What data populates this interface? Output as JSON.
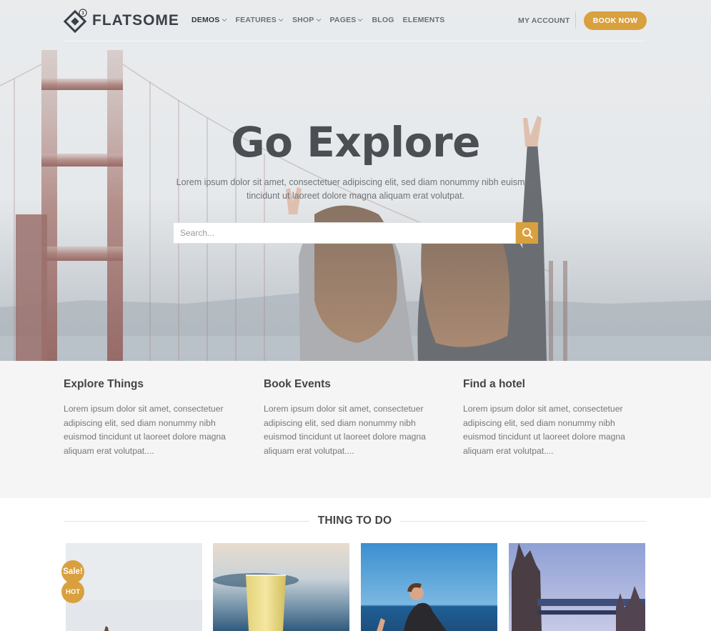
{
  "brand": {
    "name": "FLATSOME",
    "accent_color": "#d9a03e",
    "logo_badge": "3"
  },
  "nav": {
    "items": [
      {
        "label": "DEMOS",
        "has_dropdown": true,
        "active": true
      },
      {
        "label": "FEATURES",
        "has_dropdown": true,
        "active": false
      },
      {
        "label": "SHOP",
        "has_dropdown": true,
        "active": false
      },
      {
        "label": "PAGES",
        "has_dropdown": true,
        "active": false
      },
      {
        "label": "BLOG",
        "has_dropdown": false,
        "active": false
      },
      {
        "label": "ELEMENTS",
        "has_dropdown": false,
        "active": false
      }
    ],
    "account_label": "MY ACCOUNT",
    "cta_label": "BOOK NOW"
  },
  "hero": {
    "title": "Go Explore",
    "subtitle": "Lorem ipsum dolor sit amet, consectetuer adipiscing elit, sed diam nonummy nibh euismod tincidunt ut laoreet dolore magna aliquam erat volutpat.",
    "search_placeholder": "Search...",
    "search_value": ""
  },
  "features": [
    {
      "title": "Explore Things",
      "text": "Lorem ipsum dolor sit amet, consectetuer adipiscing elit, sed diam nonummy nibh euismod tincidunt ut laoreet dolore magna aliquam erat volutpat...."
    },
    {
      "title": "Book Events",
      "text": "Lorem ipsum dolor sit amet, consectetuer adipiscing elit, sed diam nonummy nibh euismod tincidunt ut laoreet dolore magna aliquam erat volutpat...."
    },
    {
      "title": "Find a hotel",
      "text": "Lorem ipsum dolor sit amet, consectetuer adipiscing elit, sed diam nonummy nibh euismod tincidunt ut laoreet dolore magna aliquam erat volutpat...."
    }
  ],
  "things_section": {
    "title": "THING TO DO",
    "badges": {
      "sale": "Sale!",
      "hot": "HOT"
    }
  },
  "icons": {
    "logo": "diamond-logo-icon",
    "dropdown": "chevron-down-icon",
    "search": "search-icon"
  }
}
